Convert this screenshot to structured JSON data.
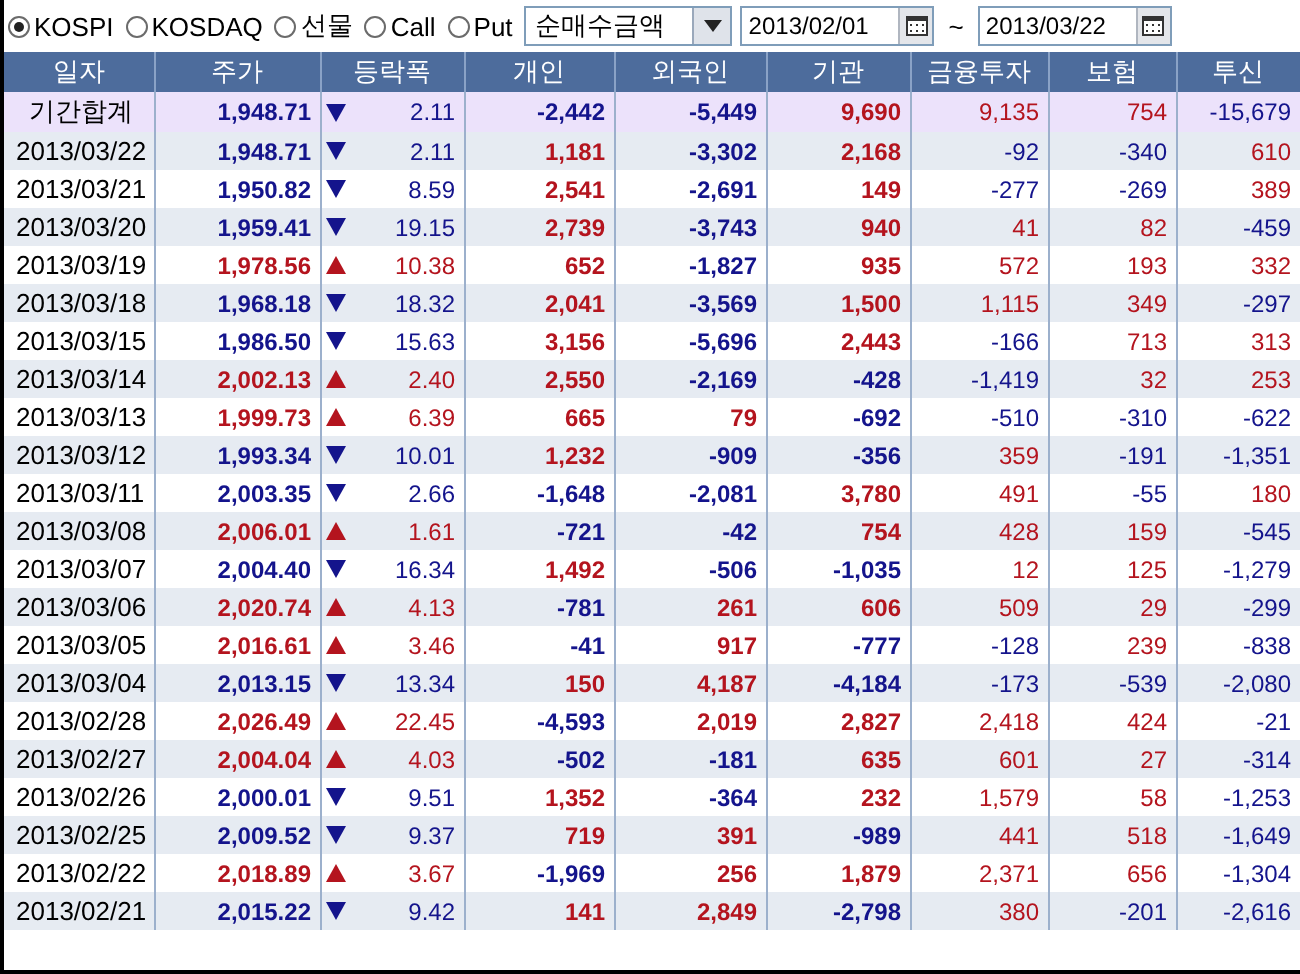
{
  "toolbar": {
    "markets": [
      {
        "label": "KOSPI",
        "selected": true
      },
      {
        "label": "KOSDAQ",
        "selected": false
      },
      {
        "label": "선물",
        "selected": false
      },
      {
        "label": "Call",
        "selected": false
      },
      {
        "label": "Put",
        "selected": false
      }
    ],
    "metric": "순매수금액",
    "start_date": "2013/02/01",
    "range_separator": "~",
    "end_date": "2013/03/22"
  },
  "table": {
    "columns": [
      "일자",
      "주가",
      "등락폭",
      "개인",
      "외국인",
      "기관",
      "금융투자",
      "보험",
      "투신"
    ],
    "summary": {
      "label": "기간합계",
      "price": "1,948.71",
      "rising": false,
      "change": "2.11",
      "values": [
        "-2,442",
        "-5,449",
        "9,690",
        "9,135",
        "754",
        "-15,679"
      ]
    },
    "rows": [
      {
        "date": "2013/03/22",
        "price": "1,948.71",
        "rising": false,
        "change": "2.11",
        "values": [
          "1,181",
          "-3,302",
          "2,168",
          "-92",
          "-340",
          "610"
        ]
      },
      {
        "date": "2013/03/21",
        "price": "1,950.82",
        "rising": false,
        "change": "8.59",
        "values": [
          "2,541",
          "-2,691",
          "149",
          "-277",
          "-269",
          "389"
        ]
      },
      {
        "date": "2013/03/20",
        "price": "1,959.41",
        "rising": false,
        "change": "19.15",
        "values": [
          "2,739",
          "-3,743",
          "940",
          "41",
          "82",
          "-459"
        ]
      },
      {
        "date": "2013/03/19",
        "price": "1,978.56",
        "rising": true,
        "change": "10.38",
        "values": [
          "652",
          "-1,827",
          "935",
          "572",
          "193",
          "332"
        ]
      },
      {
        "date": "2013/03/18",
        "price": "1,968.18",
        "rising": false,
        "change": "18.32",
        "values": [
          "2,041",
          "-3,569",
          "1,500",
          "1,115",
          "349",
          "-297"
        ]
      },
      {
        "date": "2013/03/15",
        "price": "1,986.50",
        "rising": false,
        "change": "15.63",
        "values": [
          "3,156",
          "-5,696",
          "2,443",
          "-166",
          "713",
          "313"
        ]
      },
      {
        "date": "2013/03/14",
        "price": "2,002.13",
        "rising": true,
        "change": "2.40",
        "values": [
          "2,550",
          "-2,169",
          "-428",
          "-1,419",
          "32",
          "253"
        ]
      },
      {
        "date": "2013/03/13",
        "price": "1,999.73",
        "rising": true,
        "change": "6.39",
        "values": [
          "665",
          "79",
          "-692",
          "-510",
          "-310",
          "-622"
        ]
      },
      {
        "date": "2013/03/12",
        "price": "1,993.34",
        "rising": false,
        "change": "10.01",
        "values": [
          "1,232",
          "-909",
          "-356",
          "359",
          "-191",
          "-1,351"
        ]
      },
      {
        "date": "2013/03/11",
        "price": "2,003.35",
        "rising": false,
        "change": "2.66",
        "values": [
          "-1,648",
          "-2,081",
          "3,780",
          "491",
          "-55",
          "180"
        ]
      },
      {
        "date": "2013/03/08",
        "price": "2,006.01",
        "rising": true,
        "change": "1.61",
        "values": [
          "-721",
          "-42",
          "754",
          "428",
          "159",
          "-545"
        ]
      },
      {
        "date": "2013/03/07",
        "price": "2,004.40",
        "rising": false,
        "change": "16.34",
        "values": [
          "1,492",
          "-506",
          "-1,035",
          "12",
          "125",
          "-1,279"
        ]
      },
      {
        "date": "2013/03/06",
        "price": "2,020.74",
        "rising": true,
        "change": "4.13",
        "values": [
          "-781",
          "261",
          "606",
          "509",
          "29",
          "-299"
        ]
      },
      {
        "date": "2013/03/05",
        "price": "2,016.61",
        "rising": true,
        "change": "3.46",
        "values": [
          "-41",
          "917",
          "-777",
          "-128",
          "239",
          "-838"
        ]
      },
      {
        "date": "2013/03/04",
        "price": "2,013.15",
        "rising": false,
        "change": "13.34",
        "values": [
          "150",
          "4,187",
          "-4,184",
          "-173",
          "-539",
          "-2,080"
        ]
      },
      {
        "date": "2013/02/28",
        "price": "2,026.49",
        "rising": true,
        "change": "22.45",
        "values": [
          "-4,593",
          "2,019",
          "2,827",
          "2,418",
          "424",
          "-21"
        ]
      },
      {
        "date": "2013/02/27",
        "price": "2,004.04",
        "rising": true,
        "change": "4.03",
        "values": [
          "-502",
          "-181",
          "635",
          "601",
          "27",
          "-314"
        ]
      },
      {
        "date": "2013/02/26",
        "price": "2,000.01",
        "rising": false,
        "change": "9.51",
        "values": [
          "1,352",
          "-364",
          "232",
          "1,579",
          "58",
          "-1,253"
        ]
      },
      {
        "date": "2013/02/25",
        "price": "2,009.52",
        "rising": false,
        "change": "9.37",
        "values": [
          "719",
          "391",
          "-989",
          "441",
          "518",
          "-1,649"
        ]
      },
      {
        "date": "2013/02/22",
        "price": "2,018.89",
        "rising": true,
        "change": "3.67",
        "values": [
          "-1,969",
          "256",
          "1,879",
          "2,371",
          "656",
          "-1,304"
        ]
      },
      {
        "date": "2013/02/21",
        "price": "2,015.22",
        "rising": false,
        "change": "9.42",
        "values": [
          "141",
          "2,849",
          "-2,798",
          "380",
          "-201",
          "-2,616"
        ]
      }
    ]
  }
}
